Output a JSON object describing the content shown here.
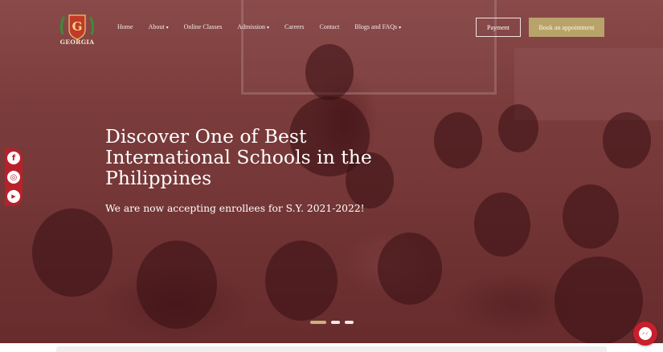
{
  "brand": {
    "name": "GEORGIA",
    "logo_letter": "G"
  },
  "nav": {
    "items": [
      {
        "label": "Home",
        "dropdown": false
      },
      {
        "label": "About",
        "dropdown": true
      },
      {
        "label": "Online Classes",
        "dropdown": false
      },
      {
        "label": "Admission",
        "dropdown": true
      },
      {
        "label": "Careers",
        "dropdown": false
      },
      {
        "label": "Contact",
        "dropdown": false
      },
      {
        "label": "Blogs and FAQs",
        "dropdown": true
      }
    ]
  },
  "buttons": {
    "payment": "Payment",
    "book": "Book an appointment"
  },
  "hero": {
    "heading": "Discover One of Best International Schools in the Philippines",
    "subheading": "We are now accepting enrollees for S.Y. 2021-2022!"
  },
  "social": [
    {
      "name": "facebook-icon",
      "glyph": "f"
    },
    {
      "name": "instagram-icon",
      "glyph": "◎"
    },
    {
      "name": "youtube-icon",
      "glyph": "▶"
    }
  ],
  "carousel": {
    "slides": 3,
    "active": 1
  },
  "colors": {
    "accent": "#b8a46a",
    "social_red": "#b8212b",
    "overlay": "#7b3c3c"
  }
}
